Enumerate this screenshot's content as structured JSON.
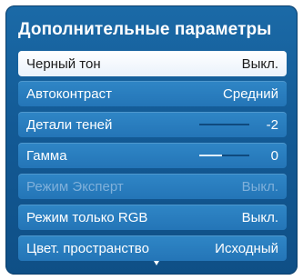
{
  "menu": {
    "title": "Дополнительные параметры",
    "items": [
      {
        "label": "Черный тон",
        "value": "Выкл."
      },
      {
        "label": "Автоконтраст",
        "value": "Средний"
      },
      {
        "label": "Детали теней",
        "value": "-2",
        "level": 0.0
      },
      {
        "label": "Гамма",
        "value": "0",
        "level": 0.45
      },
      {
        "label": "Режим Эксперт",
        "value": "Выкл.",
        "disabled": true
      },
      {
        "label": "Режим только RGB",
        "value": "Выкл."
      },
      {
        "label": "Цвет. пространство",
        "value": "Исходный"
      }
    ],
    "more_indicator": "scroll-down-arrow"
  },
  "colors": {
    "panel": "#135a95",
    "item": "#2475b7",
    "selected": "#ffffff",
    "disabled_text": "#7fb0da"
  }
}
